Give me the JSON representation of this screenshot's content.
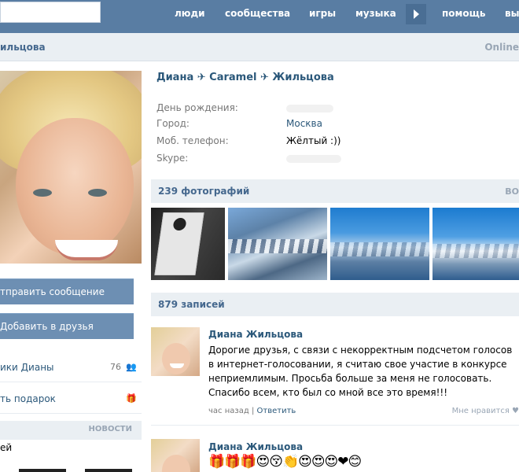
{
  "topbar": {
    "search_value": "",
    "nav": [
      "люди",
      "сообщества",
      "игры",
      "музыка",
      "помощь",
      "вы"
    ]
  },
  "profile": {
    "header_name": "ильцова",
    "online_status": "Online",
    "full_name": "Диана ✈ Caramel ✈ Жильцова",
    "info": [
      {
        "label": "День рождения:",
        "value": ""
      },
      {
        "label": "Город:",
        "value": "Москва"
      },
      {
        "label": "Моб. телефон:",
        "value": "Жёлтый :))"
      },
      {
        "label": "Skype:",
        "value": ""
      }
    ]
  },
  "sidebar": {
    "send_message": "тправить сообщение",
    "add_friend": "Добавить в друзья",
    "links": [
      {
        "label": "ики Дианы",
        "count": "76"
      },
      {
        "label": "ть подарок",
        "count": ""
      }
    ],
    "news_header": "НОВОСТИ",
    "last_item": "ей"
  },
  "photos": {
    "title": "239 фотографий",
    "more": "ВО"
  },
  "wall": {
    "title": "879 записей",
    "posts": [
      {
        "author": "Диана Жильцова",
        "text": "Дорогие друзья, с связи с некорректным подсчетом голосов в интернет-голосовании, я считаю свое участие в конкурсе неприемлимым. Просьба больше за меня не голосовать. Спасибо всем, кто был со мной все это время!!!",
        "time": "час назад",
        "separator": "|",
        "reply": "Ответить",
        "likes": "Мне нравится"
      },
      {
        "author": "Диана Жильцова",
        "emojis": "🎁🎁🎁😍😚👏😍😍😍❤😊"
      }
    ]
  },
  "icons": {
    "friends": "friends-icon",
    "gift": "gift-icon",
    "heart": "heart-icon",
    "arrow": "arrow-right-icon"
  }
}
